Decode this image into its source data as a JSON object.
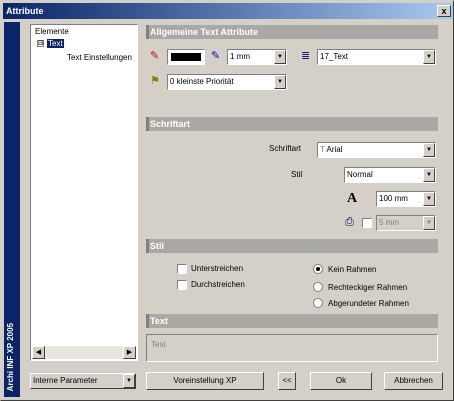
{
  "window": {
    "title": "Attribute",
    "close_glyph": "x"
  },
  "side_strip": {
    "text": "Archi INF XP 2005"
  },
  "tree": {
    "items": [
      {
        "label": "Elemente"
      },
      {
        "label": "Text",
        "expander": "⊟"
      },
      {
        "label": "Text Einstellungen"
      }
    ],
    "scroll_left": "◀",
    "scroll_right": "▶"
  },
  "sections": {
    "general": "Allgemeine Text Attribute",
    "font": "Schriftart",
    "style": "Stil",
    "text": "Text"
  },
  "general": {
    "color_icon": "pen-color-icon",
    "pen_value": "1 mm",
    "layer_value": "17_Text",
    "priority_value": "0 kleinste Priorität"
  },
  "font": {
    "font_label": "Schriftart",
    "font_value": "Arial",
    "style_label": "Stil",
    "style_value": "Normal",
    "size_value": "100 mm",
    "print_value": "5 mm"
  },
  "style": {
    "underline": "Unterstreichen",
    "strikethrough": "Durchstreichen",
    "frame_none": "Kein Rahmen",
    "frame_rect": "Rechteckiger Rahmen",
    "frame_round": "Abgerundeter Rahmen"
  },
  "text": {
    "value": "Test"
  },
  "buttons": {
    "internal_params": "Interne Parameter",
    "defaults": "Voreinstellung XP",
    "collapse": "<<",
    "ok": "Ok",
    "cancel": "Abbrechen"
  },
  "colors": {
    "titlebar": "#0a246a",
    "section": "#a9a8a4",
    "face": "#d4d0c8"
  }
}
